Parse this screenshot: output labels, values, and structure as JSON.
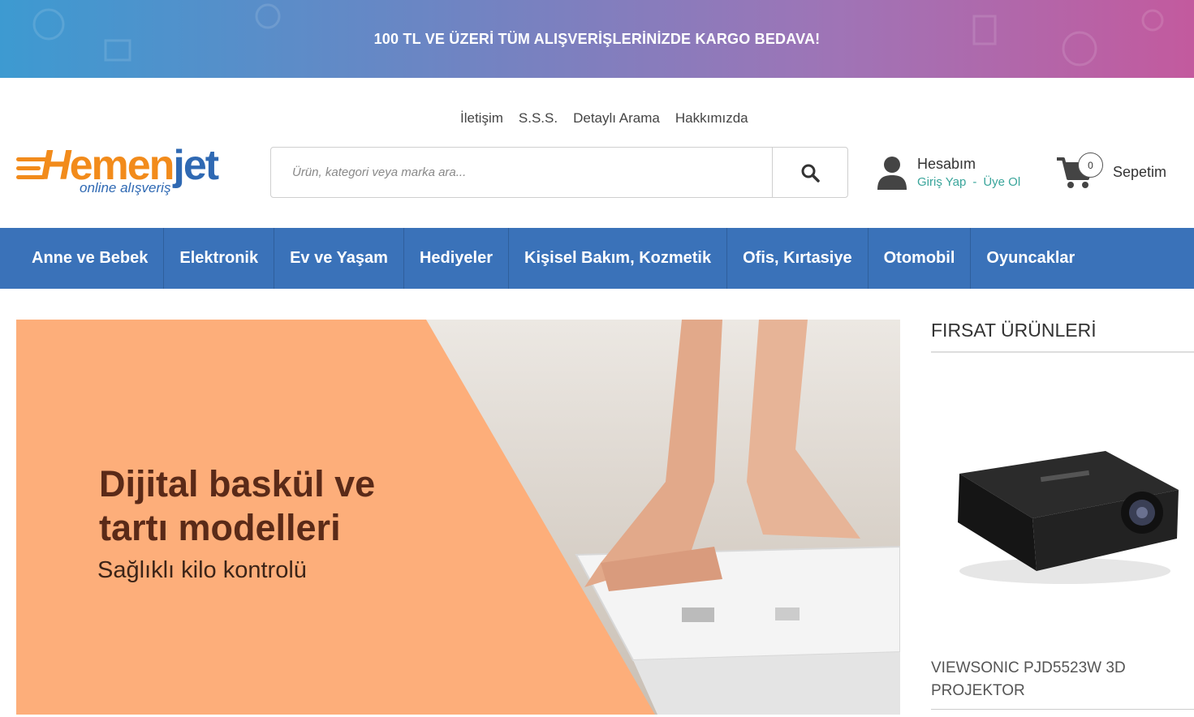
{
  "announcement": "100 TL VE ÜZERİ TÜM ALIŞVERİŞLERİNİZDE KARGO BEDAVA!",
  "top_links": [
    "İletişim",
    "S.S.S.",
    "Detaylı Arama",
    "Hakkımızda"
  ],
  "logo": {
    "brand_part1": "emen",
    "brand_h": "H",
    "brand_part2": "jet",
    "tagline": "online alışveriş"
  },
  "search": {
    "placeholder": "Ürün, kategori veya marka ara...",
    "value": ""
  },
  "account": {
    "title": "Hesabım",
    "login": "Giriş Yap",
    "separator": "-",
    "register": "Üye Ol"
  },
  "cart": {
    "count": "0",
    "label": "Sepetim"
  },
  "nav": [
    "Anne ve Bebek",
    "Elektronik",
    "Ev ve Yaşam",
    "Hediyeler",
    "Kişisel Bakım, Kozmetik",
    "Ofis, Kırtasiye",
    "Otomobil",
    "Oyuncaklar"
  ],
  "banner": {
    "headline": "Dijital baskül ve tartı modelleri",
    "subline": "Sağlıklı kilo kontrolü"
  },
  "deals": {
    "title": "FIRSAT ÜRÜNLERİ",
    "product_name": "VIEWSONIC PJD5523W 3D PROJEKTOR"
  },
  "colors": {
    "nav_bg": "#3a72b9",
    "brand_orange": "#f28b1b",
    "brand_blue": "#2f69b3",
    "link_teal": "#3aa59b",
    "banner_orange": "#fdae7a"
  }
}
